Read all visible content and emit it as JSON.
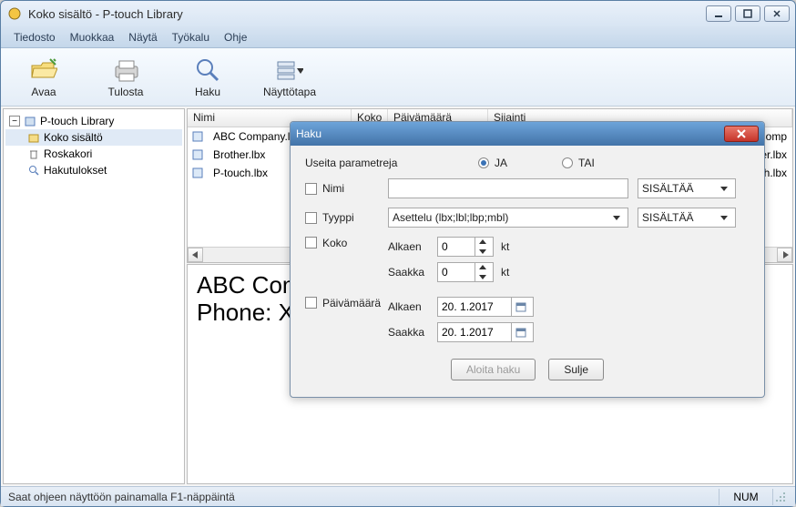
{
  "window": {
    "title": "Koko sisältö - P-touch Library"
  },
  "menu": {
    "file": "Tiedosto",
    "edit": "Muokkaa",
    "view": "Näytä",
    "tools": "Työkalu",
    "help": "Ohje"
  },
  "toolbar": {
    "open": "Avaa",
    "print": "Tulosta",
    "search": "Haku",
    "viewmode": "Näyttötapa"
  },
  "tree": {
    "root": "P-touch Library",
    "all": "Koko sisältö",
    "trash": "Roskakori",
    "results": "Hakutulokset"
  },
  "columns": {
    "name": "Nimi",
    "size": "Koko",
    "date": "Päivämäärä",
    "location": "Sijainti"
  },
  "list": [
    {
      "name": "ABC Company.lbx",
      "location_tail": "C Comp"
    },
    {
      "name": "Brother.lbx",
      "location_tail": "her.lbx"
    },
    {
      "name": "P-touch.lbx",
      "location_tail": "uch.lbx"
    }
  ],
  "preview": {
    "line1": "ABC Com",
    "line2": "Phone: X"
  },
  "dialog": {
    "title": "Haku",
    "multi_label": "Useita parametreja",
    "and": "JA",
    "or": "TAI",
    "name_label": "Nimi",
    "type_label": "Tyyppi",
    "type_value": "Asettelu (lbx;lbl;lbp;mbl)",
    "size_label": "Koko",
    "date_label": "Päivämäärä",
    "from": "Alkaen",
    "to": "Saakka",
    "size_from": "0",
    "size_to": "0",
    "unit": "kt",
    "date_from": "20. 1.2017",
    "date_to": "20. 1.2017",
    "op_contains": "SISÄLTÄÄ",
    "start": "Aloita haku",
    "close": "Sulje"
  },
  "status": {
    "hint": "Saat ohjeen näyttöön painamalla F1-näppäintä",
    "num": "NUM"
  }
}
